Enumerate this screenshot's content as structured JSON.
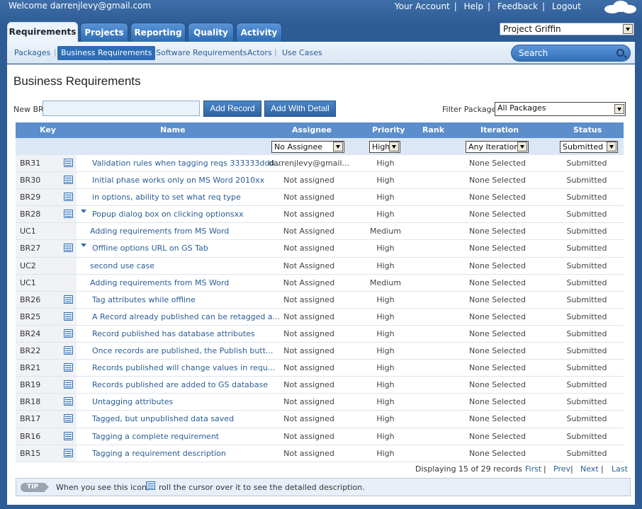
{
  "header": {
    "welcome": "Welcome darrenjlevy@gmail.com",
    "links": [
      "Your Account",
      "Help",
      "Feedback",
      "Logout"
    ]
  },
  "tabs": [
    "Requirements",
    "Projects",
    "Reporting",
    "Quality",
    "Activity"
  ],
  "project_select": {
    "value": "Project Griffin"
  },
  "subnav": {
    "items": [
      "Packages",
      "Business Requirements",
      "Software Requirements",
      "Actors",
      "Use Cases"
    ],
    "search_label": "Search"
  },
  "page": {
    "title": "Business Requirements",
    "new_br_label": "New BR",
    "add_record": "Add Record",
    "add_with_detail": "Add With Detail",
    "filter_label": "Filter Packages",
    "filter_value": "All Packages"
  },
  "grid": {
    "columns": [
      "Key",
      "Name",
      "Assignee",
      "Priority",
      "Rank",
      "Iteration",
      "Status"
    ],
    "filters": {
      "assignee": "No Assignee",
      "priority": "High",
      "iteration": "Any Iteration",
      "status": "Submitted"
    },
    "rows": [
      {
        "key": "BR31",
        "icon": true,
        "chevron": false,
        "name": "Validation rules when tagging reqs 333333ddd...",
        "assignee": "darrenjlevy@gmail...",
        "priority": "High",
        "iteration": "None Selected",
        "status": "Submitted"
      },
      {
        "key": "BR30",
        "icon": true,
        "chevron": false,
        "name": "Initial phase works only on MS Word 2010xx",
        "assignee": "Not assigned",
        "priority": "High",
        "iteration": "None Selected",
        "status": "Submitted"
      },
      {
        "key": "BR29",
        "icon": true,
        "chevron": false,
        "name": "in options, ability to set what req type",
        "assignee": "Not assigned",
        "priority": "High",
        "iteration": "None Selected",
        "status": "Submitted"
      },
      {
        "key": "BR28",
        "icon": true,
        "chevron": true,
        "name": "Popup dialog box on clicking optionsxx",
        "assignee": "Not assigned",
        "priority": "High",
        "iteration": "None Selected",
        "status": "Submitted"
      },
      {
        "key": "UC1",
        "icon": false,
        "chevron": false,
        "name": "Adding requirements from MS Word",
        "assignee": "Not Assigned",
        "priority": "Medium",
        "iteration": "None Selected",
        "status": "Submitted"
      },
      {
        "key": "BR27",
        "icon": true,
        "chevron": true,
        "name": "Offline options URL on GS Tab",
        "assignee": "Not assigned",
        "priority": "High",
        "iteration": "None Selected",
        "status": "Submitted"
      },
      {
        "key": "UC2",
        "icon": false,
        "chevron": false,
        "name": "second use case",
        "assignee": "Not Assigned",
        "priority": "High",
        "iteration": "None Selected",
        "status": "Submitted"
      },
      {
        "key": "UC1",
        "icon": false,
        "chevron": false,
        "name": "Adding requirements from MS Word",
        "assignee": "Not Assigned",
        "priority": "Medium",
        "iteration": "None Selected",
        "status": "Submitted"
      },
      {
        "key": "BR26",
        "icon": true,
        "chevron": false,
        "name": "Tag attributes while offline",
        "assignee": "Not assigned",
        "priority": "High",
        "iteration": "None Selected",
        "status": "Submitted"
      },
      {
        "key": "BR25",
        "icon": true,
        "chevron": false,
        "name": "A Record already published can be retagged a...",
        "assignee": "Not assigned",
        "priority": "High",
        "iteration": "None Selected",
        "status": "Submitted"
      },
      {
        "key": "BR24",
        "icon": true,
        "chevron": false,
        "name": "Record published has database attributes",
        "assignee": "Not assigned",
        "priority": "High",
        "iteration": "None Selected",
        "status": "Submitted"
      },
      {
        "key": "BR22",
        "icon": true,
        "chevron": false,
        "name": "Once records are published, the Publish butt...",
        "assignee": "Not assigned",
        "priority": "High",
        "iteration": "None Selected",
        "status": "Submitted"
      },
      {
        "key": "BR21",
        "icon": true,
        "chevron": false,
        "name": "Records published will change values in requ...",
        "assignee": "Not assigned",
        "priority": "High",
        "iteration": "None Selected",
        "status": "Submitted"
      },
      {
        "key": "BR19",
        "icon": true,
        "chevron": false,
        "name": "Records published are added to GS database",
        "assignee": "Not assigned",
        "priority": "High",
        "iteration": "None Selected",
        "status": "Submitted"
      },
      {
        "key": "BR18",
        "icon": true,
        "chevron": false,
        "name": "Untagging attributes",
        "assignee": "Not assigned",
        "priority": "High",
        "iteration": "None Selected",
        "status": "Submitted"
      },
      {
        "key": "BR17",
        "icon": true,
        "chevron": false,
        "name": "Tagged, but unpublished data saved",
        "assignee": "Not assigned",
        "priority": "High",
        "iteration": "None Selected",
        "status": "Submitted"
      },
      {
        "key": "BR16",
        "icon": true,
        "chevron": false,
        "name": "Tagging a complete requirement",
        "assignee": "Not assigned",
        "priority": "High",
        "iteration": "None Selected",
        "status": "Submitted"
      },
      {
        "key": "BR15",
        "icon": true,
        "chevron": false,
        "name": "Tagging a requirement description",
        "assignee": "Not assigned",
        "priority": "High",
        "iteration": "None Selected",
        "status": "Submitted"
      }
    ]
  },
  "pager": {
    "summary": "Displaying 15 of 29 records",
    "first": "First",
    "prev": "Prev",
    "next": "Next",
    "last": "Last"
  },
  "tip": {
    "badge": "TIP",
    "before": "When you see this icon,",
    "after": "roll the cursor over it to see the detailed description."
  }
}
